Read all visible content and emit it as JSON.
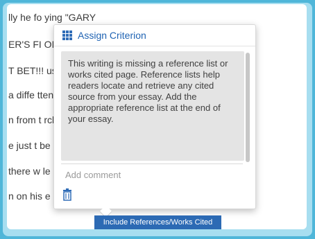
{
  "essay_lines": [
    "lly he fo                                    ying \"GARY",
    "ER'S FI                                        ONES, WE'RE",
    "T BET!!!                                        usion he shou",
    "a diffe                                          tten more",
    "n from t                                        rch. Lastly he",
    "e just t                                        be as much",
    "there w                                        le more wate",
    "n on his                                        e bike ride."
  ],
  "popup": {
    "icon": "grid-icon",
    "title": "Assign Criterion",
    "explanation": "This writing is missing a reference list or works cited page. Reference lists help readers locate and retrieve any cited source from your essay. Add the appropriate reference list at the end of your essay.",
    "comment_placeholder": "Add comment",
    "delete_icon": "trash-icon"
  },
  "criterion_button": "Include References/Works Cited",
  "colors": {
    "outer": "#4fb6d9",
    "accent": "#2c6ab4",
    "title": "#1f63b3"
  }
}
